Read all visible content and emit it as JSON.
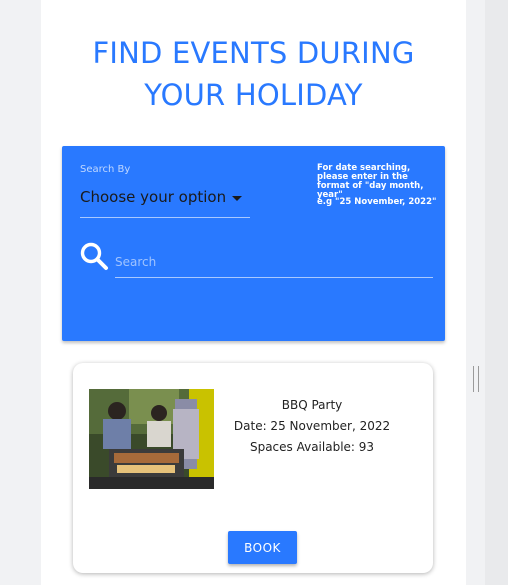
{
  "header": {
    "title_line1": "FIND EVENTS DURING",
    "title_line2": "YOUR HOLIDAY"
  },
  "search_panel": {
    "search_by_label": "Search By",
    "select_value": "Choose your option",
    "date_hint": "For date searching, please enter in the format of \"day month, year\"",
    "date_example": "e.g \"25 November, 2022\"",
    "search_placeholder": "Search",
    "search_value": "",
    "accent_color": "#2979ff"
  },
  "events": [
    {
      "image": "bbq-party-photo",
      "name": "BBQ Party",
      "date": "Date: 25 November, 2022",
      "spaces": "Spaces Available: 93",
      "book_label": "BOOK"
    }
  ]
}
